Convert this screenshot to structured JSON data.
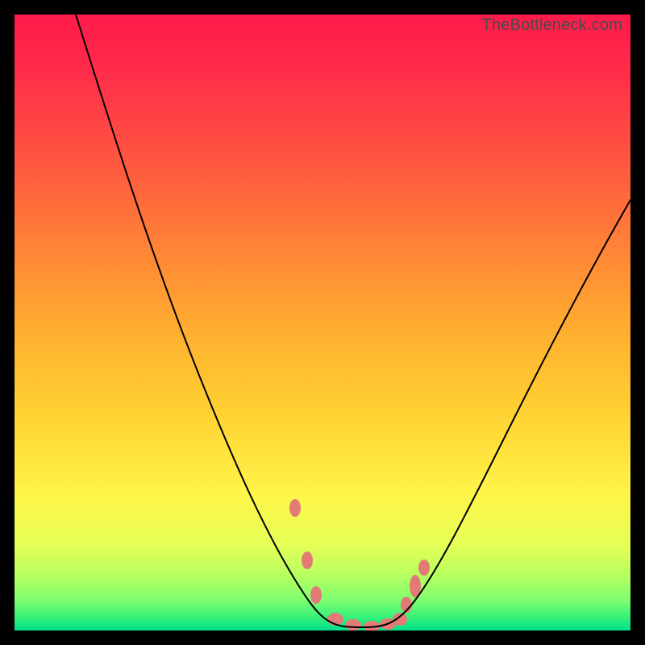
{
  "watermark": "TheBottleneck.com",
  "chart_data": {
    "type": "line",
    "title": "",
    "xlabel": "",
    "ylabel": "",
    "xlim": [
      0,
      100
    ],
    "ylim": [
      0,
      100
    ],
    "series": [
      {
        "name": "curve",
        "x": [
          10,
          15,
          20,
          25,
          30,
          35,
          40,
          45,
          48,
          50,
          52,
          55,
          58,
          60,
          63,
          66,
          70,
          75,
          80,
          85,
          90,
          95,
          100
        ],
        "values": [
          100,
          90,
          80,
          70,
          59,
          47,
          34,
          20,
          12,
          7,
          3,
          1,
          0,
          0,
          0,
          2,
          6,
          13,
          22,
          32,
          43,
          54,
          65
        ]
      }
    ],
    "markers": {
      "comment": "salmon blobs near the trough",
      "points": [
        {
          "x": 45.5,
          "y": 20
        },
        {
          "x": 47.5,
          "y": 11
        },
        {
          "x": 49,
          "y": 5
        },
        {
          "x": 52,
          "y": 1
        },
        {
          "x": 55,
          "y": 0
        },
        {
          "x": 58,
          "y": 0
        },
        {
          "x": 60.5,
          "y": 0.5
        },
        {
          "x": 62.5,
          "y": 2
        },
        {
          "x": 63.5,
          "y": 4
        },
        {
          "x": 65,
          "y": 7
        },
        {
          "x": 66.5,
          "y": 10
        }
      ]
    },
    "background_gradient": {
      "top": "#ff1a4a",
      "mid": "#ffd233",
      "bottom": "#00e08c"
    }
  }
}
